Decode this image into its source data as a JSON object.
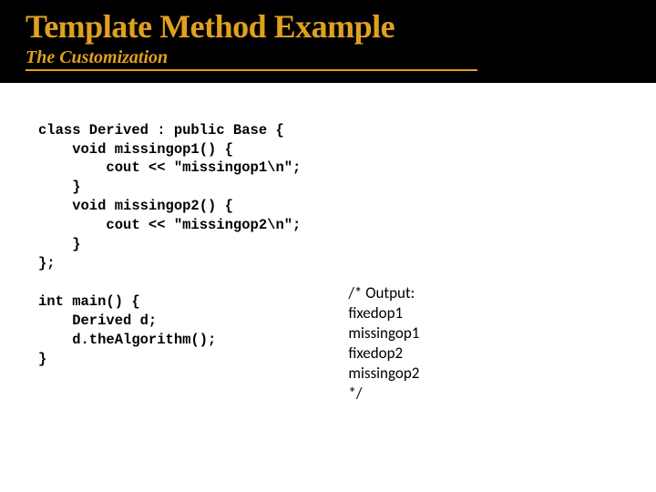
{
  "header": {
    "title": "Template Method Example",
    "subtitle": "The Customization"
  },
  "code": "class Derived : public Base {\n    void missingop1() {\n        cout << \"missingop1\\n\";\n    }\n    void missingop2() {\n        cout << \"missingop2\\n\";\n    }\n};\n\nint main() {\n    Derived d;\n    d.theAlgorithm();\n}",
  "output": {
    "lines": [
      "/* Output:",
      "fixedop1",
      "missingop1",
      "fixedop2",
      "missingop2",
      "*/"
    ]
  }
}
